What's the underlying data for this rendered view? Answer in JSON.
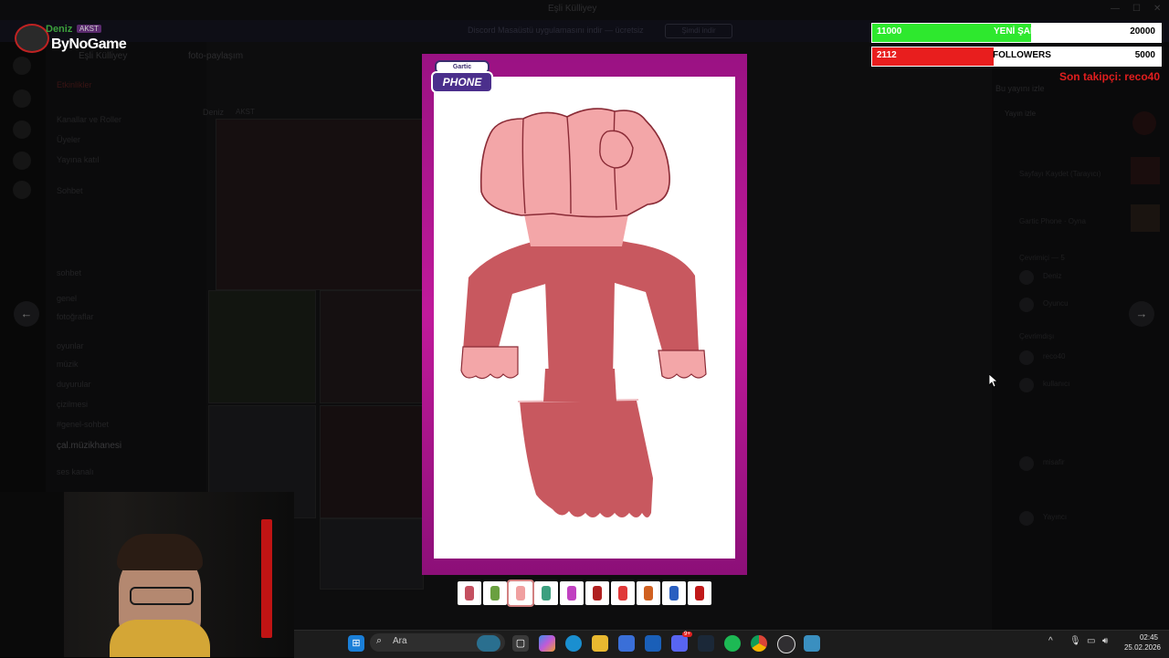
{
  "window": {
    "title": "Eşli Külliyey",
    "controls": [
      "—",
      "☐",
      "✕"
    ]
  },
  "banner": {
    "text": "Discord Masaüstü uygulamasını indir — ücretsiz",
    "button": "Şimdi indir"
  },
  "sidebar": {
    "server_name": "Eşli Külliyey",
    "items": [
      "Etkinlikler",
      "Kanallar ve Roller",
      "Üyeler",
      "Yayına katıl",
      "Sohbet",
      "sohbet",
      "genel",
      "fotoğraflar",
      "oyunlar",
      "müzik",
      "duyurular",
      "çizilmesi",
      "#genel-sohbet",
      "ses kanalı"
    ],
    "channel_highlight": "çal.müzikhanesi"
  },
  "chat": {
    "channel": "foto-paylaşım",
    "author": "Deniz",
    "tag": "AKST"
  },
  "members": {
    "heading": "Bu yayını izle",
    "items": [
      "Yayın izle",
      "Sayfayı Kaydet (Tarayıcı)",
      "Gartic Phone · Oyna",
      "Çevrimiçi — 5",
      "Deniz",
      "Oyuncu",
      "Çevrimdışı",
      "reco40",
      "kullanıcı",
      "misafir",
      "Yayıncı"
    ]
  },
  "logo": {
    "username": "Deniz",
    "tag": "AKST",
    "brand": "ByNoGame"
  },
  "overlay": {
    "song_bar": {
      "current": "11000",
      "label": "YENİ ŞARKI",
      "goal": "20000",
      "progress": 0.55,
      "color": "#2ee82e"
    },
    "followers_bar": {
      "current": "2112",
      "label": "FOLLOWERS",
      "goal": "5000",
      "progress": 0.42,
      "color": "#e81e1e"
    },
    "last_follower": "Son takipçi: reco40"
  },
  "gartic": {
    "logo_top": "Gartic",
    "logo_bottom": "PHONE",
    "drawing": "character-with-fist-head",
    "thumbnails": [
      {
        "color": "#c45060"
      },
      {
        "color": "#6aa040"
      },
      {
        "color": "#f0a0a0"
      },
      {
        "color": "#3c9f7f"
      },
      {
        "color": "#c040c0"
      },
      {
        "color": "#b02020"
      },
      {
        "color": "#e03838"
      },
      {
        "color": "#d06020"
      },
      {
        "color": "#2a5fc0"
      },
      {
        "color": "#c01818"
      }
    ],
    "selected_index": 2
  },
  "nav": {
    "prev": "←",
    "next": "→"
  },
  "taskbar": {
    "search_placeholder": "Ara",
    "icons": [
      "windows-start-icon",
      "copilot-icon",
      "task-view-icon",
      "copilot-app-icon",
      "edge-icon",
      "file-explorer-icon",
      "store-icon",
      "mail-icon",
      "discord-icon",
      "steam-icon",
      "spotify-icon",
      "chrome-icon",
      "obs-icon",
      "app-icon"
    ],
    "discord_badge": "9+",
    "tray_chevron": "^",
    "time": "02:45",
    "date": "25.02.2026"
  }
}
